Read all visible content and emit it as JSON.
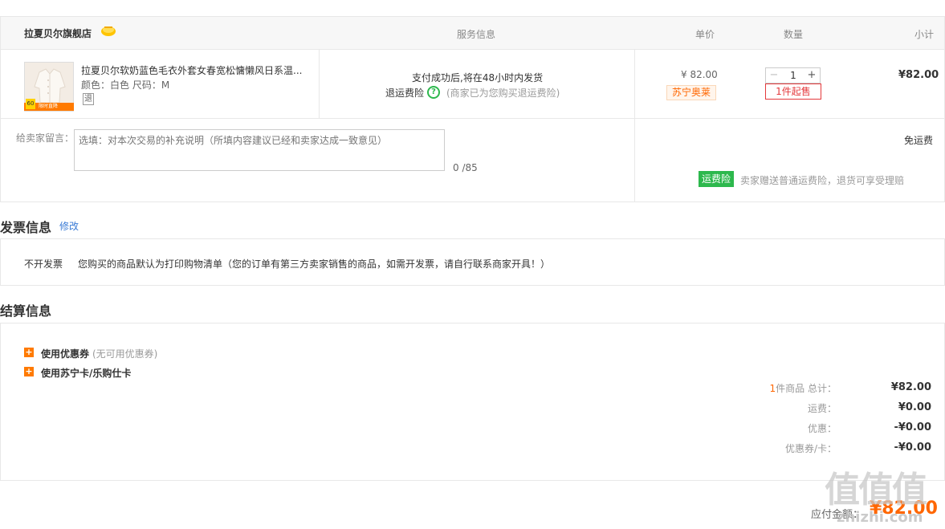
{
  "store": {
    "name": "拉夏贝尔旗舰店",
    "headers": {
      "service": "服务信息",
      "unit_price": "单价",
      "quantity": "数量",
      "subtotal": "小计"
    }
  },
  "item": {
    "title": "拉夏贝尔软奶蓝色毛衣外套女春宽松慵懒风日系温...",
    "attributes": "颜色：白色   尺码：M",
    "return_mark": "退",
    "thumb_tag": "60",
    "thumb_bar": "限时直降",
    "shipping_text": "支付成功后,将在48小时内发货",
    "insurance_label": "退运费险",
    "insurance_note": "(商家已为您购买退运费险)",
    "price": "¥ 82.00",
    "price_tag": "苏宁奥莱",
    "quantity": "1",
    "min_sale": "1件起售",
    "subtotal": "¥82.00"
  },
  "message": {
    "label": "给卖家留言：",
    "placeholder": "选填：对本次交易的补充说明（所填内容建议已经和卖家达成一致意见）",
    "count": "0 /85"
  },
  "delivery": {
    "fee": "免运费",
    "insurance_badge": "运费险",
    "insurance_desc": "卖家赠送普通运费险，退货可享受理赔"
  },
  "invoice": {
    "title": "发票信息",
    "edit": "修改",
    "type": "不开发票",
    "desc": "您购买的商品默认为打印购物清单（您的订单有第三方卖家销售的商品，如需开发票，请自行联系商家开具！）"
  },
  "settlement": {
    "title": "结算信息",
    "coupon_label": "使用优惠券",
    "coupon_note": "(无可用优惠券)",
    "card_label": "使用苏宁卡/乐购仕卡",
    "items_count": "1",
    "items_label": "件商品 总计：",
    "total": "¥82.00",
    "shipping_label": "运费：",
    "shipping": "¥0.00",
    "discount_label": "优惠：",
    "discount": "-¥0.00",
    "coupon_card_label": "优惠券/卡：",
    "coupon_card": "-¥0.00",
    "pay_label": "应付金额：",
    "pay_amount": "¥82.00"
  },
  "watermark": {
    "logo": "值值值",
    "url": "zhizhi.com"
  },
  "colors": {
    "accent": "#ff6600",
    "green": "#2db84d",
    "red": "#e4393c",
    "link": "#3a7bd5"
  }
}
